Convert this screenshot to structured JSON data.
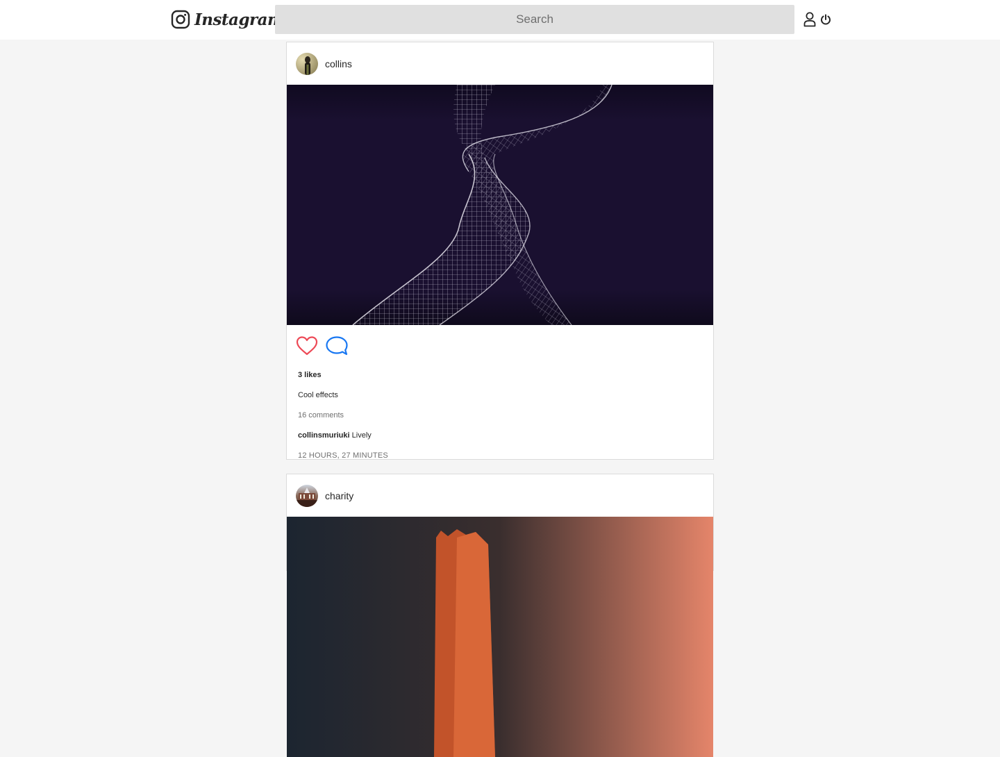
{
  "header": {
    "brand": "Instagram",
    "search_placeholder": "Search",
    "icons": [
      "instagram-logo-icon",
      "user-icon",
      "power-icon"
    ]
  },
  "posts": [
    {
      "username": "collins",
      "likes": "3 likes",
      "caption": "Cool effects",
      "comments_count": "16 comments",
      "comment": {
        "author": "collinsmuriuki",
        "text": "Lively"
      },
      "time": "12 HOURS, 27 MINUTES"
    },
    {
      "username": "charity"
    }
  ],
  "colors": {
    "heart": "#ed4956",
    "comment": "#1877f2",
    "page_bg": "#f5f5f5",
    "search_bg": "#e0e0e0"
  }
}
